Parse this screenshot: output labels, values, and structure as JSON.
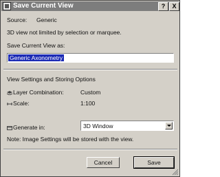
{
  "window": {
    "title": "Save Current View",
    "help_label": "?",
    "close_label": "X"
  },
  "source": {
    "label": "Source:",
    "value": "Generic",
    "note": "3D view not limited by selection or marquee."
  },
  "save_as": {
    "label": "Save Current View as:",
    "value": "Generic Axonometry"
  },
  "settings": {
    "section_title": "View Settings and Storing Options",
    "layer_combination_label": "Layer Combination:",
    "layer_combination_value": "Custom",
    "scale_label": "Scale:",
    "scale_value": "1:100"
  },
  "generate_in": {
    "label": "Generate in:",
    "selected": "3D Window"
  },
  "note": "Note: Image Settings will be stored with the view.",
  "buttons": {
    "cancel": "Cancel",
    "save": "Save"
  }
}
